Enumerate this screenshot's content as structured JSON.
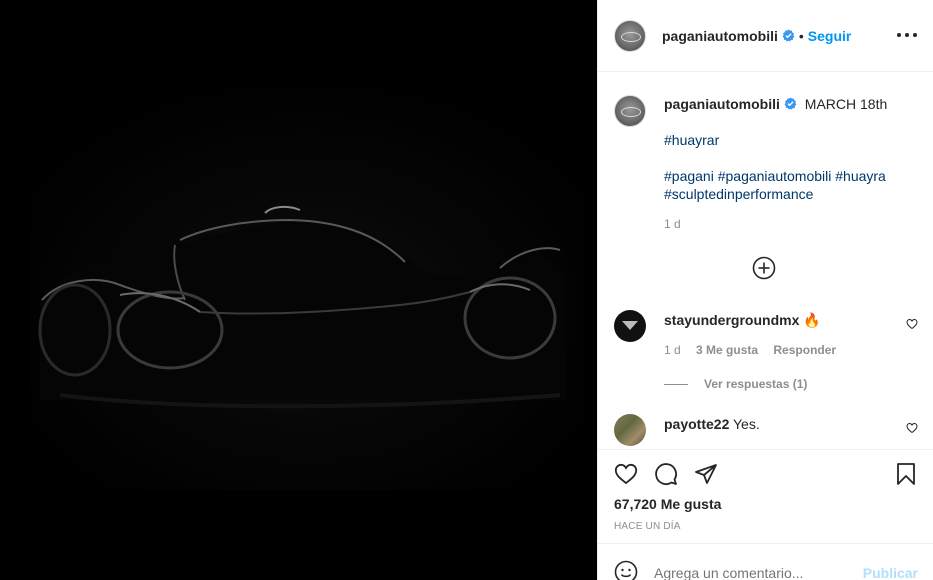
{
  "post": {
    "username": "paganiautomobili",
    "follow_label": "Seguir",
    "dot": "•"
  },
  "caption": {
    "username": "paganiautomobili",
    "date": "MARCH 18th",
    "line1": "#huayrar",
    "line2": "#pagani #paganiautomobili #huayra #sculptedinperformance",
    "time": "1 d"
  },
  "comments": [
    {
      "username": "stayundergroundmx",
      "text": "🔥",
      "time": "1 d",
      "likes": "3 Me gusta",
      "reply": "Responder"
    },
    {
      "username": "payotte22",
      "text": "Yes."
    }
  ],
  "replies_label": "Ver respuestas (1)",
  "likes_count": "67,720 Me gusta",
  "posted_ago": "HACE UN DÍA",
  "add_comment": {
    "placeholder": "Agrega un comentario...",
    "post_label": "Publicar"
  },
  "colors": {
    "accent": "#0095f6",
    "hashtag": "#00376b",
    "muted": "#8e8e8e",
    "verified": "#3897f0"
  },
  "icons": [
    "verified-badge-icon",
    "more-options-icon",
    "add-circle-icon",
    "heart-icon",
    "comment-icon",
    "share-icon",
    "bookmark-icon",
    "emoji-icon"
  ]
}
